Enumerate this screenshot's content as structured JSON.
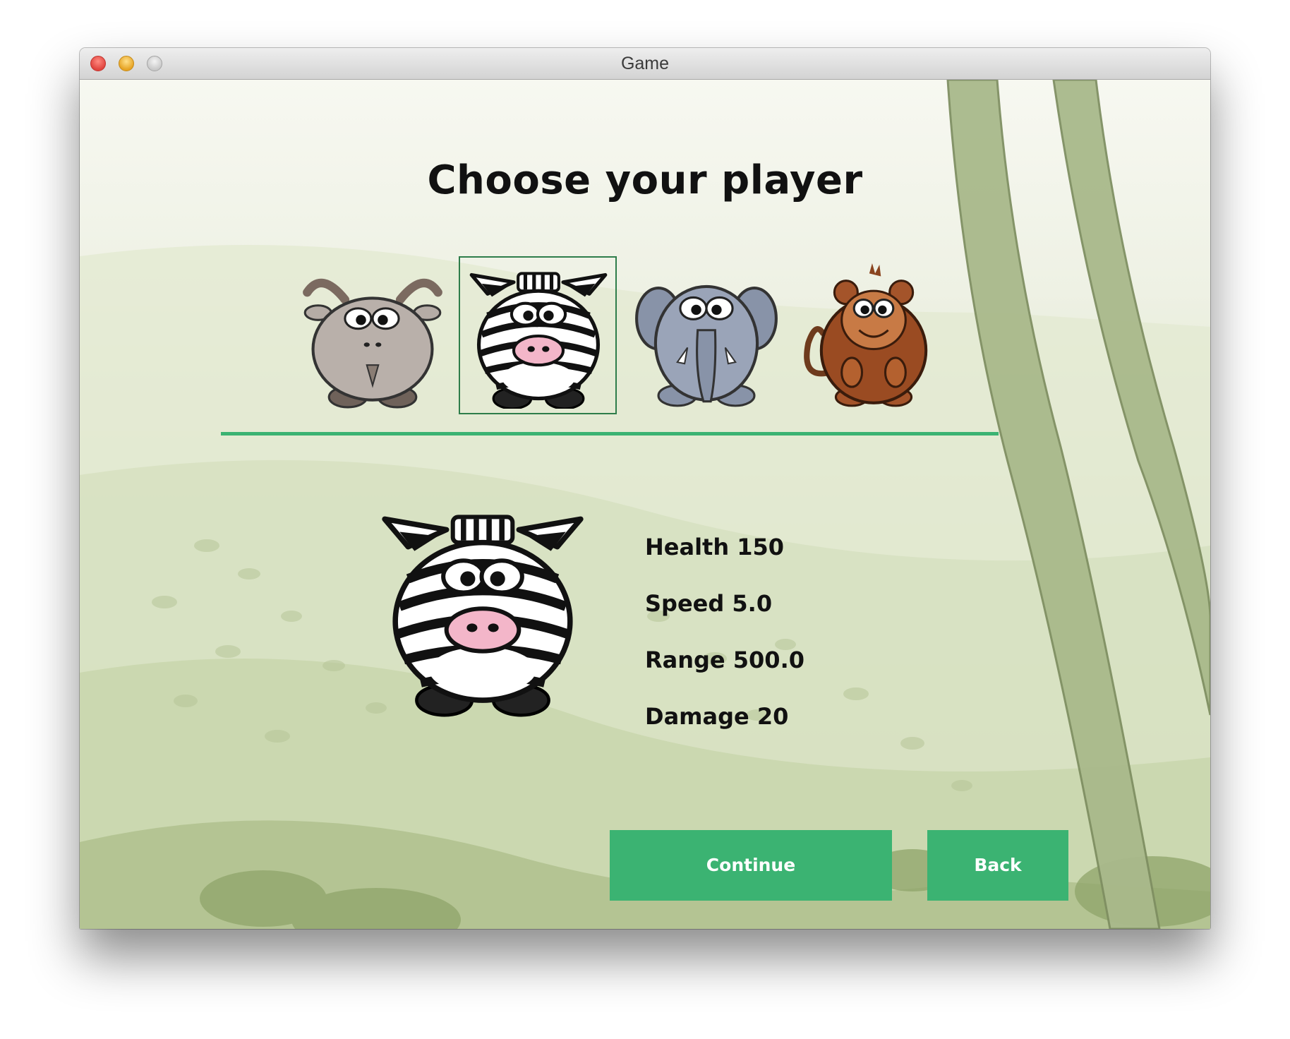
{
  "window": {
    "title": "Game"
  },
  "screen": {
    "heading": "Choose your player"
  },
  "characters": [
    {
      "id": "goat",
      "icon": "goat-icon",
      "selected": false
    },
    {
      "id": "zebra",
      "icon": "zebra-icon",
      "selected": true
    },
    {
      "id": "elephant",
      "icon": "elephant-icon",
      "selected": false
    },
    {
      "id": "monkey",
      "icon": "monkey-icon",
      "selected": false
    }
  ],
  "stats": {
    "health": "Health 150",
    "speed": "Speed 5.0",
    "range": "Range 500.0",
    "damage": "Damage 20"
  },
  "buttons": {
    "continue": "Continue",
    "back": "Back"
  },
  "colors": {
    "accent": "#3bb372",
    "selection_border": "#2e7d4a",
    "background": "#e9ece1"
  }
}
